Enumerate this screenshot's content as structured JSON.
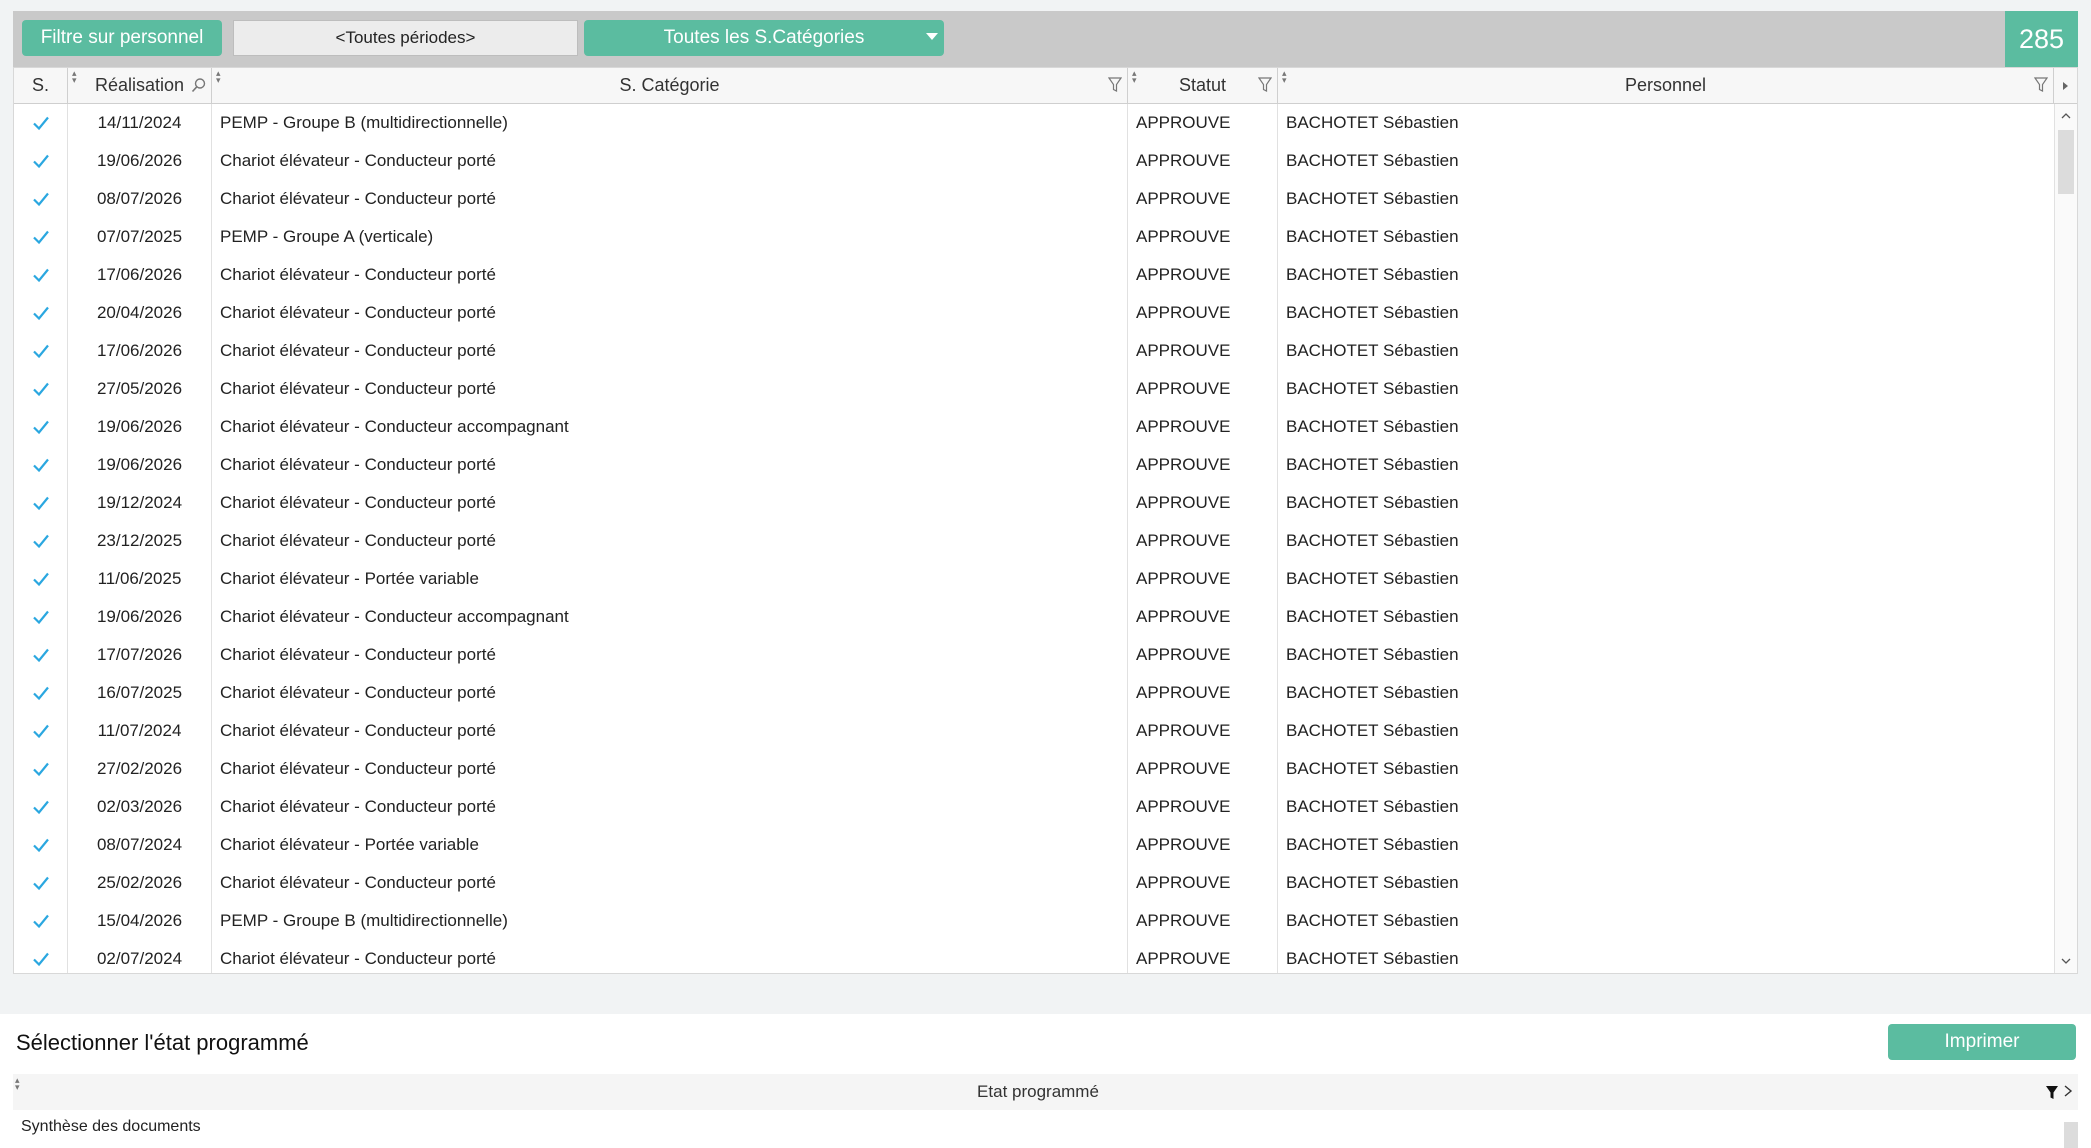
{
  "toolbar": {
    "filter_button": "Filtre sur personnel",
    "period_value": "<Toutes périodes>",
    "category_select": "Toutes les S.Catégories",
    "count": "285"
  },
  "colors": {
    "accent": "#5bbca0",
    "check": "#2aa7e0"
  },
  "grid": {
    "columns": [
      "S.",
      "Réalisation",
      "S. Catégorie",
      "Statut",
      "Personnel"
    ],
    "rows": [
      {
        "checked": true,
        "date": "14/11/2024",
        "category": "PEMP - Groupe B (multidirectionnelle)",
        "status": "APPROUVE",
        "person": "BACHOTET Sébastien"
      },
      {
        "checked": true,
        "date": "19/06/2026",
        "category": "Chariot élévateur - Conducteur porté",
        "status": "APPROUVE",
        "person": "BACHOTET Sébastien"
      },
      {
        "checked": true,
        "date": "08/07/2026",
        "category": "Chariot élévateur - Conducteur porté",
        "status": "APPROUVE",
        "person": "BACHOTET Sébastien"
      },
      {
        "checked": true,
        "date": "07/07/2025",
        "category": "PEMP - Groupe A (verticale)",
        "status": "APPROUVE",
        "person": "BACHOTET Sébastien"
      },
      {
        "checked": true,
        "date": "17/06/2026",
        "category": "Chariot élévateur - Conducteur porté",
        "status": "APPROUVE",
        "person": "BACHOTET Sébastien"
      },
      {
        "checked": true,
        "date": "20/04/2026",
        "category": "Chariot élévateur - Conducteur porté",
        "status": "APPROUVE",
        "person": "BACHOTET Sébastien"
      },
      {
        "checked": true,
        "date": "17/06/2026",
        "category": "Chariot élévateur - Conducteur porté",
        "status": "APPROUVE",
        "person": "BACHOTET Sébastien"
      },
      {
        "checked": true,
        "date": "27/05/2026",
        "category": "Chariot élévateur - Conducteur porté",
        "status": "APPROUVE",
        "person": "BACHOTET Sébastien"
      },
      {
        "checked": true,
        "date": "19/06/2026",
        "category": "Chariot élévateur - Conducteur accompagnant",
        "status": "APPROUVE",
        "person": "BACHOTET Sébastien"
      },
      {
        "checked": true,
        "date": "19/06/2026",
        "category": "Chariot élévateur - Conducteur porté",
        "status": "APPROUVE",
        "person": "BACHOTET Sébastien"
      },
      {
        "checked": true,
        "date": "19/12/2024",
        "category": "Chariot élévateur - Conducteur porté",
        "status": "APPROUVE",
        "person": "BACHOTET Sébastien"
      },
      {
        "checked": true,
        "date": "23/12/2025",
        "category": "Chariot élévateur - Conducteur porté",
        "status": "APPROUVE",
        "person": "BACHOTET Sébastien"
      },
      {
        "checked": true,
        "date": "11/06/2025",
        "category": "Chariot élévateur - Portée variable",
        "status": "APPROUVE",
        "person": "BACHOTET Sébastien"
      },
      {
        "checked": true,
        "date": "19/06/2026",
        "category": "Chariot élévateur - Conducteur accompagnant",
        "status": "APPROUVE",
        "person": "BACHOTET Sébastien"
      },
      {
        "checked": true,
        "date": "17/07/2026",
        "category": "Chariot élévateur - Conducteur porté",
        "status": "APPROUVE",
        "person": "BACHOTET Sébastien"
      },
      {
        "checked": true,
        "date": "16/07/2025",
        "category": "Chariot élévateur - Conducteur porté",
        "status": "APPROUVE",
        "person": "BACHOTET Sébastien"
      },
      {
        "checked": true,
        "date": "11/07/2024",
        "category": "Chariot élévateur - Conducteur porté",
        "status": "APPROUVE",
        "person": "BACHOTET Sébastien"
      },
      {
        "checked": true,
        "date": "27/02/2026",
        "category": "Chariot élévateur - Conducteur porté",
        "status": "APPROUVE",
        "person": "BACHOTET Sébastien"
      },
      {
        "checked": true,
        "date": "02/03/2026",
        "category": "Chariot élévateur - Conducteur porté",
        "status": "APPROUVE",
        "person": "BACHOTET Sébastien"
      },
      {
        "checked": true,
        "date": "08/07/2024",
        "category": "Chariot élévateur - Portée variable",
        "status": "APPROUVE",
        "person": "BACHOTET Sébastien"
      },
      {
        "checked": true,
        "date": "25/02/2026",
        "category": "Chariot élévateur - Conducteur porté",
        "status": "APPROUVE",
        "person": "BACHOTET Sébastien"
      },
      {
        "checked": true,
        "date": "15/04/2026",
        "category": "PEMP - Groupe B (multidirectionnelle)",
        "status": "APPROUVE",
        "person": "BACHOTET Sébastien"
      },
      {
        "checked": true,
        "date": "02/07/2024",
        "category": "Chariot élévateur - Conducteur porté",
        "status": "APPROUVE",
        "person": "BACHOTET Sébastien"
      }
    ]
  },
  "bottom": {
    "title": "Sélectionner l'état programmé",
    "print_button": "Imprimer",
    "column": "Etat programmé",
    "rows": [
      "Synthèse des documents"
    ]
  },
  "icons": [
    "sort-icon",
    "search-icon",
    "filter-icon",
    "scroll-right-icon",
    "scroll-up-icon",
    "scroll-down-icon",
    "checkmark-icon",
    "dropdown-caret-icon"
  ]
}
